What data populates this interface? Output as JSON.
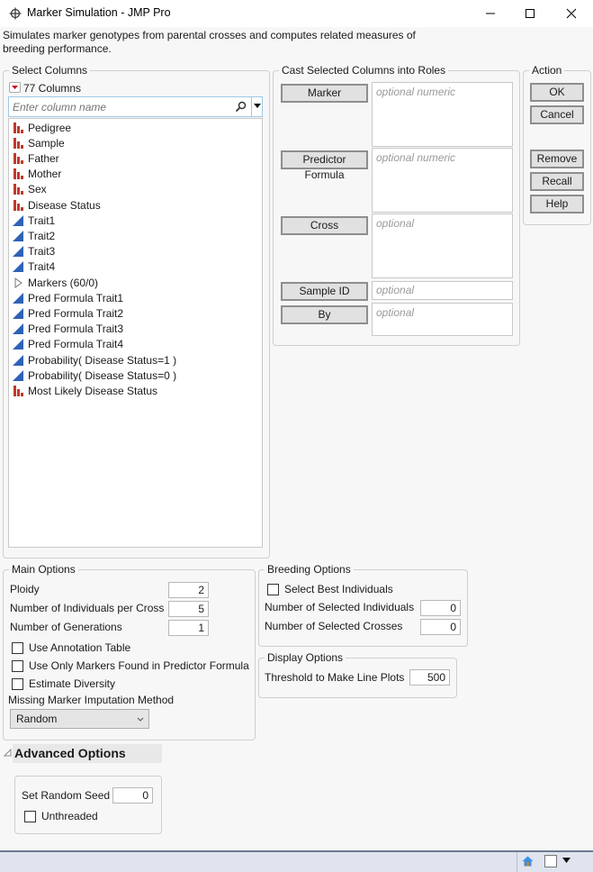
{
  "window": {
    "title": "Marker Simulation - JMP Pro",
    "app_icon": "jmp-crosshair-icon",
    "controls": [
      "minimize",
      "maximize",
      "close"
    ]
  },
  "description": "Simulates marker genotypes from parental crosses and computes related measures of breeding performance.",
  "select_columns": {
    "legend": "Select Columns",
    "count_label": "77 Columns",
    "search_placeholder": "Enter column name",
    "items": [
      {
        "label": "Pedigree",
        "type": "nominal"
      },
      {
        "label": "Sample",
        "type": "nominal"
      },
      {
        "label": "Father",
        "type": "nominal"
      },
      {
        "label": "Mother",
        "type": "nominal"
      },
      {
        "label": "Sex",
        "type": "nominal"
      },
      {
        "label": "Disease Status",
        "type": "nominal"
      },
      {
        "label": "Trait1",
        "type": "continuous"
      },
      {
        "label": "Trait2",
        "type": "continuous"
      },
      {
        "label": "Trait3",
        "type": "continuous"
      },
      {
        "label": "Trait4",
        "type": "continuous"
      },
      {
        "label": "Markers (60/0)",
        "type": "group"
      },
      {
        "label": "Pred Formula Trait1",
        "type": "continuous"
      },
      {
        "label": "Pred Formula Trait2",
        "type": "continuous"
      },
      {
        "label": "Pred Formula Trait3",
        "type": "continuous"
      },
      {
        "label": "Pred Formula Trait4",
        "type": "continuous"
      },
      {
        "label": "Probability( Disease Status=1 )",
        "type": "continuous"
      },
      {
        "label": "Probability( Disease Status=0 )",
        "type": "continuous"
      },
      {
        "label": "Most Likely Disease Status",
        "type": "nominal"
      }
    ]
  },
  "roles": {
    "legend": "Cast Selected Columns into Roles",
    "items": [
      {
        "button": "Marker",
        "placeholder": "optional numeric"
      },
      {
        "button": "Predictor Formula",
        "placeholder": "optional numeric"
      },
      {
        "button": "Cross",
        "placeholder": "optional"
      },
      {
        "button": "Sample ID",
        "placeholder": "optional"
      },
      {
        "button": "By",
        "placeholder": "optional"
      }
    ]
  },
  "action": {
    "legend": "Action",
    "ok": "OK",
    "cancel": "Cancel",
    "remove": "Remove",
    "recall": "Recall",
    "help": "Help"
  },
  "main_options": {
    "legend": "Main Options",
    "ploidy_label": "Ploidy",
    "ploidy_value": "2",
    "individuals_label": "Number of Individuals per Cross",
    "individuals_value": "5",
    "generations_label": "Number of Generations",
    "generations_value": "1",
    "use_annotation_label": "Use Annotation Table",
    "use_annotation_checked": false,
    "use_only_markers_label": "Use Only Markers Found in Predictor Formula",
    "use_only_markers_checked": false,
    "estimate_diversity_label": "Estimate Diversity",
    "estimate_diversity_checked": false,
    "imputation_label": "Missing Marker Imputation Method",
    "imputation_value": "Random"
  },
  "breeding_options": {
    "legend": "Breeding Options",
    "select_best_label": "Select Best Individuals",
    "select_best_checked": false,
    "selected_individuals_label": "Number of Selected Individuals",
    "selected_individuals_value": "0",
    "selected_crosses_label": "Number of Selected Crosses",
    "selected_crosses_value": "0"
  },
  "display_options": {
    "legend": "Display Options",
    "threshold_label": "Threshold to Make Line Plots",
    "threshold_value": "500"
  },
  "advanced_options": {
    "title": "Advanced Options",
    "seed_label": "Set Random Seed",
    "seed_value": "0",
    "unthreaded_label": "Unthreaded",
    "unthreaded_checked": false
  },
  "colors": {
    "nominal_icon": "#c0392b",
    "continuous_icon": "#2e62b8",
    "search_border": "#9ec8e6",
    "statusbar": "#dfe4ee"
  }
}
